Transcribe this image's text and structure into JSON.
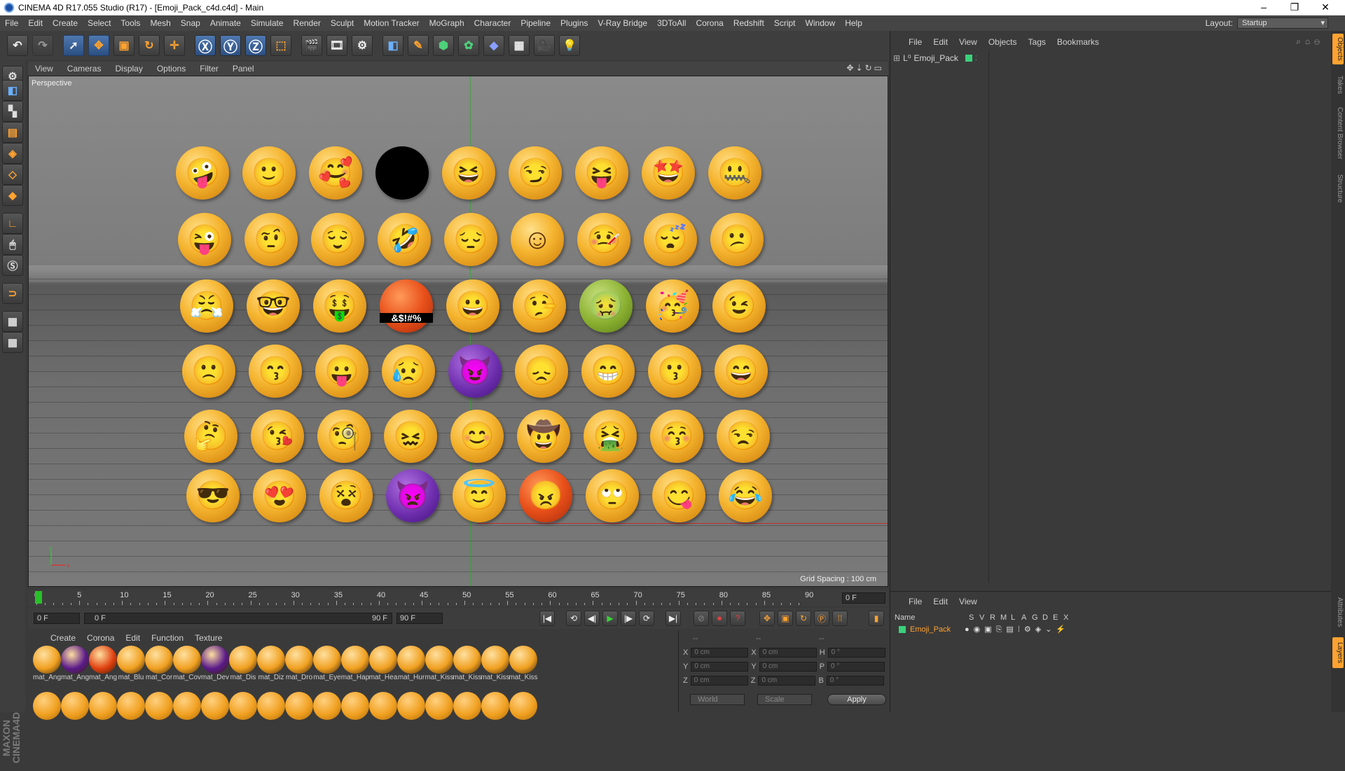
{
  "window": {
    "title": "CINEMA 4D R17.055 Studio (R17) - [Emoji_Pack_c4d.c4d] - Main"
  },
  "menu": [
    "File",
    "Edit",
    "Create",
    "Select",
    "Tools",
    "Mesh",
    "Snap",
    "Animate",
    "Simulate",
    "Render",
    "Sculpt",
    "Motion Tracker",
    "MoGraph",
    "Character",
    "Pipeline",
    "Plugins",
    "V-Ray Bridge",
    "3DToAll",
    "Corona",
    "Redshift",
    "Script",
    "Window",
    "Help"
  ],
  "layout": {
    "label": "Layout:",
    "value": "Startup"
  },
  "viewport": {
    "menu": [
      "View",
      "Cameras",
      "Display",
      "Options",
      "Filter",
      "Panel"
    ],
    "camera_label": "Perspective",
    "grid_spacing": "Grid Spacing : 100 cm",
    "swear_text": "&$!#%"
  },
  "objects": {
    "menu": [
      "File",
      "Edit",
      "View",
      "Objects",
      "Tags",
      "Bookmarks"
    ],
    "item": "Emoji_Pack"
  },
  "side_tabs": [
    "Objects",
    "Takes",
    "Content Browser",
    "Structure"
  ],
  "side_tabs_lower": [
    "Attributes",
    "Layers"
  ],
  "timeline": {
    "ticks": [
      "0",
      "5",
      "10",
      "15",
      "20",
      "25",
      "30",
      "35",
      "40",
      "45",
      "50",
      "55",
      "60",
      "65",
      "70",
      "75",
      "80",
      "85",
      "90"
    ],
    "current_frame": "0 F",
    "start": "0 F",
    "range_start": "0 F",
    "range_end": "90 F",
    "end": "90 F"
  },
  "materials": {
    "menu": [
      "Create",
      "Corona",
      "Edit",
      "Function",
      "Texture"
    ],
    "labels": [
      "mat_Ang",
      "mat_Ang",
      "mat_Ang",
      "mat_Blu",
      "mat_Cor",
      "mat_Cov",
      "mat_Dev",
      "mat_Dis",
      "mat_Diz",
      "mat_Dro",
      "mat_Eye",
      "mat_Hap",
      "mat_Hea",
      "mat_Hur",
      "mat_Kiss",
      "mat_Kiss",
      "mat_Kiss",
      "mat_Kiss"
    ]
  },
  "coordinates": {
    "header": [
      "--",
      "--",
      "--"
    ],
    "rows": [
      {
        "a": "X",
        "v1": "0 cm",
        "b": "X",
        "v2": "0 cm",
        "c": "H",
        "v3": "0 °"
      },
      {
        "a": "Y",
        "v1": "0 cm",
        "b": "Y",
        "v2": "0 cm",
        "c": "P",
        "v3": "0 °"
      },
      {
        "a": "Z",
        "v1": "0 cm",
        "b": "Z",
        "v2": "0 cm",
        "c": "B",
        "v3": "0 °"
      }
    ],
    "space": "World",
    "mode": "Scale",
    "apply": "Apply"
  },
  "layers": {
    "menu": [
      "File",
      "Edit",
      "View"
    ],
    "columns": [
      "Name",
      "S",
      "V",
      "R",
      "M",
      "L",
      "A",
      "G",
      "D",
      "E",
      "X"
    ],
    "item": "Emoji_Pack"
  }
}
